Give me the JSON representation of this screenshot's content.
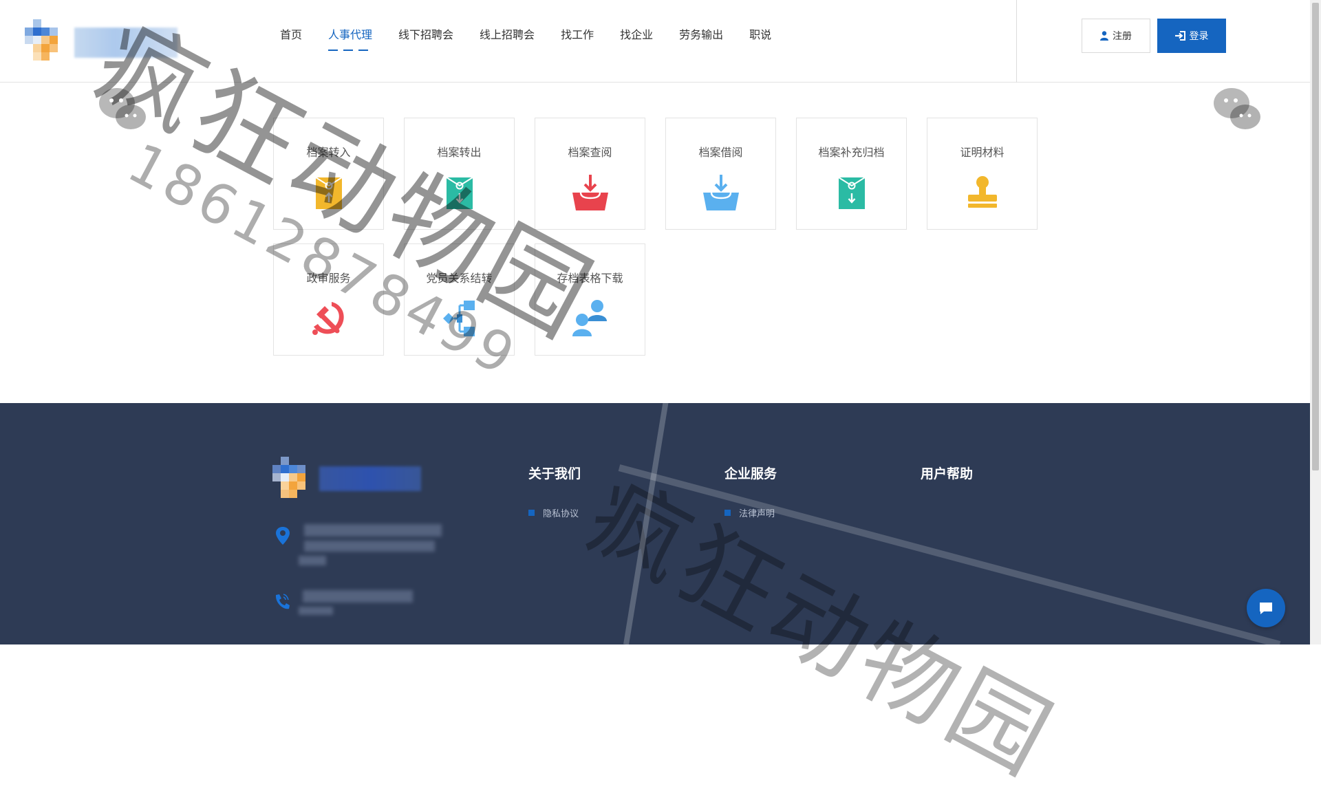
{
  "header": {
    "nav": [
      "首页",
      "人事代理",
      "线下招聘会",
      "线上招聘会",
      "找工作",
      "找企业",
      "劳务输出",
      "职说"
    ],
    "active_index": 1,
    "register_label": "注册",
    "login_label": "登录"
  },
  "services": [
    {
      "label": "档案转入",
      "icon": "envelope-upload-icon",
      "color": "#f2b72c"
    },
    {
      "label": "档案转出",
      "icon": "envelope-download-icon",
      "color": "#2bbba4"
    },
    {
      "label": "档案查阅",
      "icon": "tray-download-icon",
      "color": "#e8434d"
    },
    {
      "label": "档案借阅",
      "icon": "tray-download-icon",
      "color": "#5ab0ef"
    },
    {
      "label": "档案补充归档",
      "icon": "envelope-download-icon",
      "color": "#2bbba4"
    },
    {
      "label": "证明材料",
      "icon": "stamp-icon",
      "color": "#f2b72c"
    },
    {
      "label": "政审服务",
      "icon": "hammer-sickle-icon",
      "color": "#ee4e57"
    },
    {
      "label": "党员关系结转",
      "icon": "flowchart-icon",
      "color": "#5ab0ef"
    },
    {
      "label": "存档表格下载",
      "icon": "users-icon",
      "color": "#5ab0ef"
    }
  ],
  "footer": {
    "columns": [
      {
        "title": "关于我们",
        "links": [
          "隐私协议"
        ]
      },
      {
        "title": "企业服务",
        "links": [
          "法律声明"
        ]
      },
      {
        "title": "用户帮助",
        "links": []
      }
    ],
    "icons": [
      "location-pin-icon",
      "phone-icon"
    ]
  },
  "watermark": {
    "text": "疯狂动物园",
    "number": "18612878499"
  }
}
